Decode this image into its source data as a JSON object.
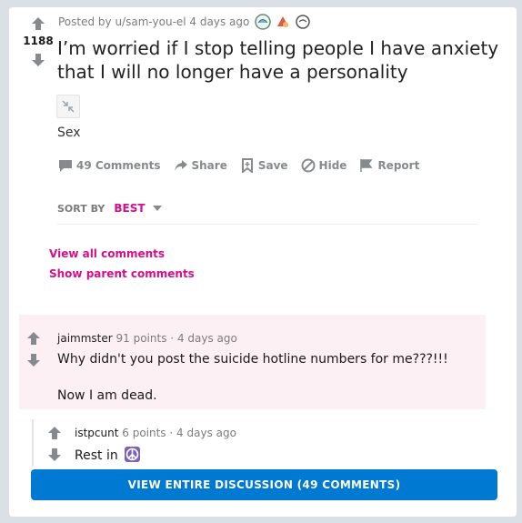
{
  "post": {
    "score": "1188",
    "meta": "Posted by u/sam-you-el 4 days ago",
    "awards": [
      "award-icon-1",
      "award-icon-2",
      "award-icon-3"
    ],
    "title": "I’m worried if I stop telling people I have anxiety that I will no longer have a personality",
    "flair": "Sex"
  },
  "actions": {
    "comments": "49 Comments",
    "share": "Share",
    "save": "Save",
    "hide": "Hide",
    "report": "Report"
  },
  "sort": {
    "label": "SORT BY",
    "value": "BEST"
  },
  "links": {
    "view_all": "View all comments",
    "show_parent": "Show parent comments"
  },
  "comments": [
    {
      "author": "jaimmster",
      "points": "91 points",
      "sep": "·",
      "time": "4 days ago",
      "line1": "Why didn't you post the suicide hotline numbers for me???!!!",
      "line2": "Now I am dead."
    },
    {
      "author": "istpcunt",
      "points": "6 points",
      "sep": "·",
      "time": "4 days ago",
      "line1": "Rest in"
    }
  ],
  "button": {
    "view_entire": "VIEW ENTIRE DISCUSSION (49 COMMENTS)"
  },
  "colors": {
    "accent_pink": "#d70e8a",
    "primary_blue": "#0079d3",
    "highlight": "#fdf0f5"
  }
}
